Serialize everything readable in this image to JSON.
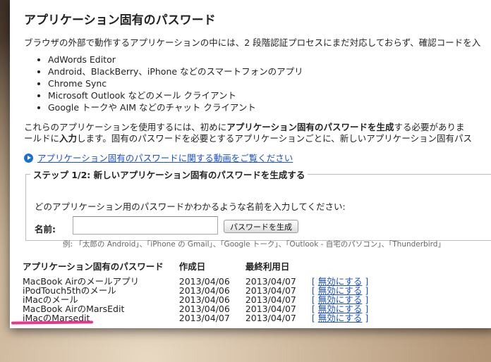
{
  "colors": {
    "link": "#1a4fd6",
    "annotation": "#e8368f",
    "icon": "#1a6fd0"
  },
  "title": "アプリケーション固有のパスワード",
  "intro": "ブラウザの外部で動作するアプリケーションの中には、2 段階認証プロセスにまだ対応しておらず、確認コードを入",
  "apps": [
    "AdWords Editor",
    "Android、BlackBerry、iPhone などのスマートフォンのアプリ",
    "Chrome Sync",
    "Microsoft Outlook などのメール クライアント",
    "Google トークや AIM などのチャット クライアント"
  ],
  "para": {
    "line1_pre": "これらのアプリケーションを使用するには、初めに",
    "line1_bold": "アプリケーション固有のパスワードを生成",
    "line1_post": "する必要がありま",
    "line2_pre": "ールドに",
    "line2_bold": "入力",
    "line2_post": "します。固有のパスワードを必要とするアプリケーションごとに、新しいアプリケーション固有パス"
  },
  "video_link": {
    "icon": "play-icon",
    "label": "アプリケーション固有のパスワードに関する動画をご覧ください"
  },
  "step": {
    "legend": "ステップ 1/2: 新しいアプリケーション固有のパスワードを生成する",
    "description": "どのアプリケーション用のパスワードかわかるような名前を入力してください:",
    "name_label": "名前:",
    "name_value": "",
    "generate_button": "パスワードを生成",
    "example": "例: 「太郎の Android」、「iPhone の Gmail」、「Google トーク」、「Outlook - 自宅のパソコン」、「Thunderbird」"
  },
  "table": {
    "headers": [
      "アプリケーション固有のパスワード",
      "作成日",
      "最終利用日",
      ""
    ],
    "rows": [
      {
        "name": "MacBook Airのメールアプリ",
        "created": "2013/04/06",
        "last_used": "2013/04/07",
        "action": "無効にする"
      },
      {
        "name": "iPodTouch5thのメール",
        "created": "2013/04/06",
        "last_used": "2013/04/07",
        "action": "無効にする"
      },
      {
        "name": "iMacのメール",
        "created": "2013/04/06",
        "last_used": "2013/04/07",
        "action": "無効にする"
      },
      {
        "name": "MacBook AirのMarsEdit",
        "created": "2013/04/06",
        "last_used": "2013/04/07",
        "action": "無効にする"
      },
      {
        "name": "iMacのMarsedit",
        "created": "2013/04/07",
        "last_used": "2013/04/07",
        "action": "無効にする"
      }
    ]
  }
}
